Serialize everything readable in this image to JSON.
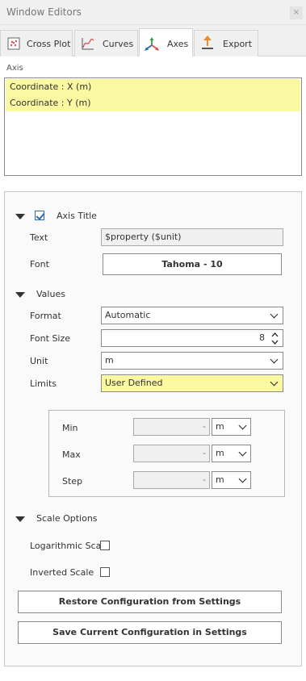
{
  "window": {
    "title": "Window Editors",
    "close_glyph": "×"
  },
  "tabs": [
    {
      "label": "Cross Plot",
      "icon": "scatter-plot-icon",
      "active": false
    },
    {
      "label": "Curves",
      "icon": "curves-icon",
      "active": false
    },
    {
      "label": "Axes",
      "icon": "axes-icon",
      "active": true
    },
    {
      "label": "Export",
      "icon": "export-icon",
      "active": false
    }
  ],
  "axis_section": {
    "label": "Axis",
    "items": [
      "Coordinate : X (m)",
      "Coordinate : Y (m)"
    ]
  },
  "axis_title": {
    "header": "Axis Title",
    "checked": true,
    "text_label": "Text",
    "text_value": "$property ($unit)",
    "font_label": "Font",
    "font_value": "Tahoma - 10"
  },
  "values": {
    "header": "Values",
    "format_label": "Format",
    "format_value": "Automatic",
    "font_size_label": "Font Size",
    "font_size_value": "8",
    "unit_label": "Unit",
    "unit_value": "m",
    "limits_label": "Limits",
    "limits_value": "User Defined"
  },
  "limits": {
    "min_label": "Min",
    "min_value": "-",
    "min_unit": "m",
    "max_label": "Max",
    "max_value": "-",
    "max_unit": "m",
    "step_label": "Step",
    "step_value": "-",
    "step_unit": "m"
  },
  "scale_options": {
    "header": "Scale Options",
    "logarithmic_label": "Logarithmic Scale",
    "logarithmic_checked": false,
    "inverted_label": "Inverted Scale",
    "inverted_checked": false
  },
  "buttons": {
    "restore": "Restore Configuration from Settings",
    "save": "Save Current Configuration in Settings"
  },
  "colors": {
    "highlight": "#faf8a0",
    "accent": "#2b6cb0"
  }
}
